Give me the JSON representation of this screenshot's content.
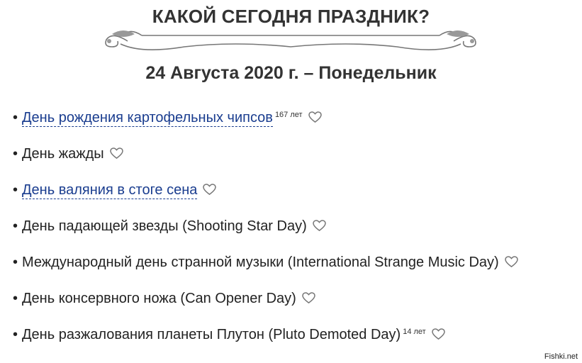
{
  "page": {
    "title": "КАКОЙ СЕГОДНЯ ПРАЗДНИК?",
    "date": "24 Августа 2020 г. – Понедельник"
  },
  "holidays": [
    {
      "bullet": "•",
      "label": "День рождения картофельных чипсов",
      "is_link": true,
      "years": "167 лет"
    },
    {
      "bullet": "•",
      "label": "День жажды",
      "is_link": false,
      "years": ""
    },
    {
      "bullet": "•",
      "label": "День валяния в стоге сена",
      "is_link": true,
      "years": ""
    },
    {
      "bullet": "•",
      "label": "День падающей звезды (Shooting Star Day)",
      "is_link": false,
      "years": ""
    },
    {
      "bullet": "•",
      "label": "Международный день странной музыки (International Strange Music Day)",
      "is_link": false,
      "years": ""
    },
    {
      "bullet": "•",
      "label": "День консервного ножа (Can Opener Day)",
      "is_link": false,
      "years": ""
    },
    {
      "bullet": "•",
      "label": "День разжалования планеты Плутон (Pluto Demoted Day)",
      "is_link": false,
      "years": "14 лет"
    }
  ],
  "icons": {
    "favorite": "heart-outline-icon",
    "ornament": "scroll-ornament-icon"
  },
  "colors": {
    "link": "#1a3d8f",
    "heading": "#333333",
    "heart": "#777777"
  },
  "watermark": "Fishki.net"
}
